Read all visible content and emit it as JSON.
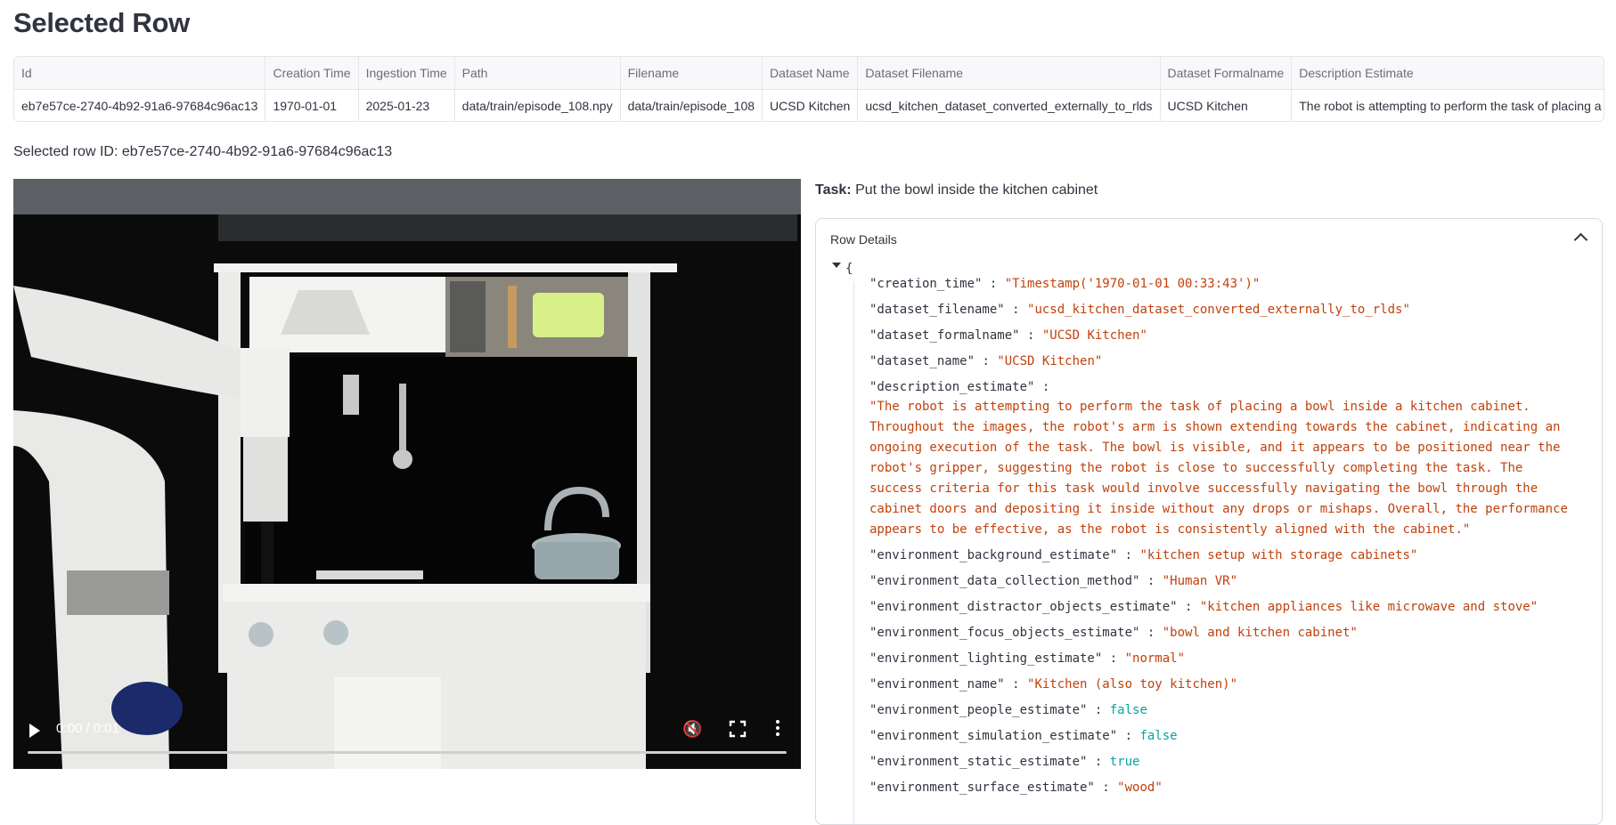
{
  "page_title": "Selected Row",
  "table": {
    "headers": [
      "Id",
      "Creation Time",
      "Ingestion Time",
      "Path",
      "Filename",
      "Dataset Name",
      "Dataset Filename",
      "Dataset Formalname",
      "Description Estimate"
    ],
    "row": [
      "eb7e57ce-2740-4b92-91a6-97684c96ac13",
      "1970-01-01",
      "2025-01-23",
      "data/train/episode_108.npy",
      "data/train/episode_108",
      "UCSD Kitchen",
      "ucsd_kitchen_dataset_converted_externally_to_rlds",
      "UCSD Kitchen",
      "The robot is attempting to perform the task of placing a bowl inside a k"
    ]
  },
  "selected_row": {
    "label": "Selected row ID:",
    "id": "eb7e57ce-2740-4b92-91a6-97684c96ac13",
    "text": "Selected row ID: eb7e57ce-2740-4b92-91a6-97684c96ac13"
  },
  "video": {
    "time": "0:00 / 0:01",
    "progress_fraction": 0.0,
    "icons": [
      "play-icon",
      "mute-icon",
      "fullscreen-icon",
      "more-options-icon"
    ]
  },
  "task": {
    "label": "Task:",
    "value": "Put the bowl inside the kitchen cabinet"
  },
  "details": {
    "title": "Row Details",
    "open_brace": "{",
    "sep": " : ",
    "entries": [
      {
        "key": "\"creation_time\"",
        "value": "\"Timestamp('1970-01-01 00:33:43')\"",
        "kind": "str"
      },
      {
        "key": "\"dataset_filename\"",
        "value": "\"ucsd_kitchen_dataset_converted_externally_to_rlds\"",
        "kind": "str"
      },
      {
        "key": "\"dataset_formalname\"",
        "value": "\"UCSD Kitchen\"",
        "kind": "str"
      },
      {
        "key": "\"dataset_name\"",
        "value": "\"UCSD Kitchen\"",
        "kind": "str"
      },
      {
        "key": "\"description_estimate\"",
        "value": "",
        "kind": "str"
      },
      {
        "key": "\"environment_background_estimate\"",
        "value": "\"kitchen setup with storage cabinets\"",
        "kind": "str"
      },
      {
        "key": "\"environment_data_collection_method\"",
        "value": "\"Human VR\"",
        "kind": "str"
      },
      {
        "key": "\"environment_distractor_objects_estimate\"",
        "value": "\"kitchen appliances like microwave and stove\"",
        "kind": "str"
      },
      {
        "key": "\"environment_focus_objects_estimate\"",
        "value": "\"bowl and kitchen cabinet\"",
        "kind": "str"
      },
      {
        "key": "\"environment_lighting_estimate\"",
        "value": "\"normal\"",
        "kind": "str"
      },
      {
        "key": "\"environment_name\"",
        "value": "\"Kitchen (also toy kitchen)\"",
        "kind": "str"
      },
      {
        "key": "\"environment_people_estimate\"",
        "value": "false",
        "kind": "bool"
      },
      {
        "key": "\"environment_simulation_estimate\"",
        "value": "false",
        "kind": "bool"
      },
      {
        "key": "\"environment_static_estimate\"",
        "value": "true",
        "kind": "bool"
      },
      {
        "key": "\"environment_surface_estimate\"",
        "value": "\"wood\"",
        "kind": "str"
      }
    ],
    "description_lines": [
      "\"The robot is attempting to perform the task of placing a bowl inside a kitchen cabinet.",
      "Throughout the images, the robot's arm is shown extending towards the cabinet, indicating an",
      "ongoing execution of the task. The bowl is visible, and it appears to be positioned near the",
      "robot's gripper, suggesting the robot is close to successfully completing the task. The",
      "success criteria for this task would involve successfully navigating the bowl through the",
      "cabinet doors and depositing it inside without any drops or mishaps. Overall, the performance",
      "appears to be effective, as the robot is consistently aligned with the cabinet.\""
    ]
  },
  "colors": {
    "string": "#c1410b",
    "boolean": "#09a3a5",
    "text": "#31333f",
    "header_text": "#6b6d7a"
  }
}
